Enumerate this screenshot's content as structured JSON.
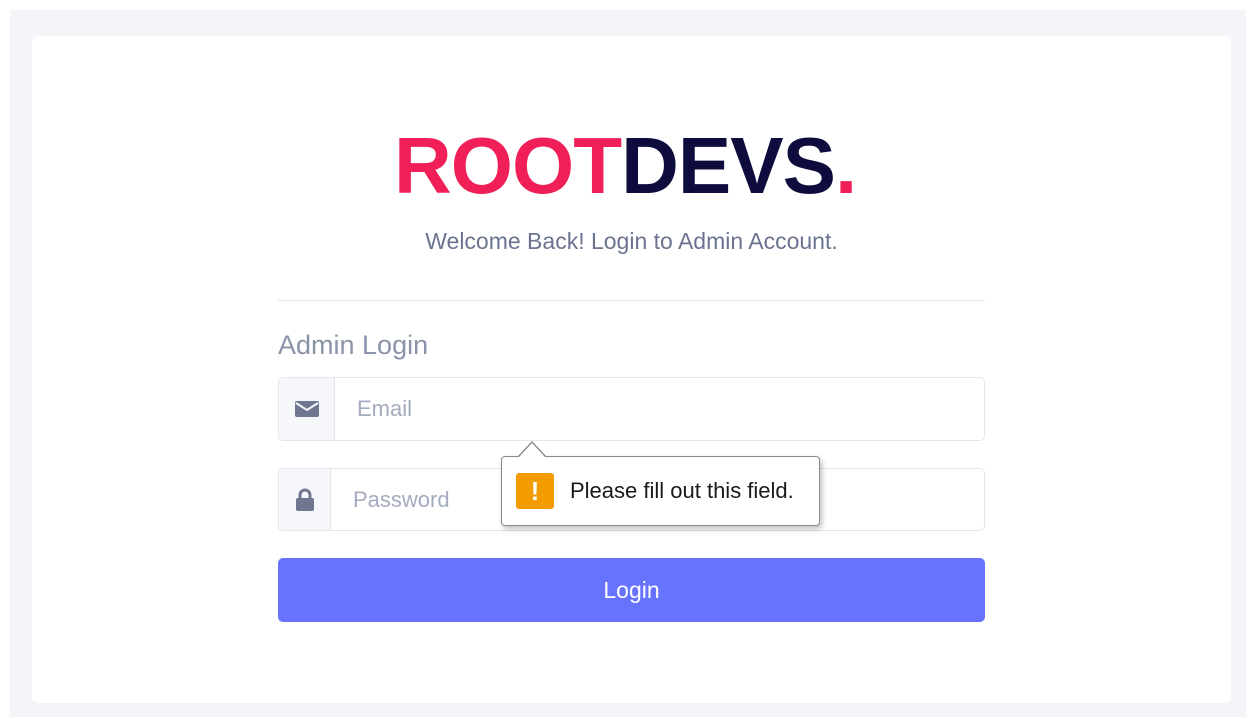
{
  "brand": {
    "part_a": "ROOT",
    "part_b": "DEVS",
    "dot": ".",
    "accent_color": "#f01f57",
    "dark_color": "#0d0c3d"
  },
  "subtitle": "Welcome Back! Login to Admin Account.",
  "form": {
    "title": "Admin Login",
    "email": {
      "icon": "envelope-icon",
      "placeholder": "Email",
      "value": ""
    },
    "password": {
      "icon": "lock-icon",
      "placeholder": "Password",
      "value": ""
    },
    "submit_label": "Login",
    "submit_color": "#6772ff"
  },
  "validation_tooltip": {
    "icon": "warning-icon",
    "icon_glyph": "!",
    "message": "Please fill out this field.",
    "icon_color": "#f39c00"
  }
}
